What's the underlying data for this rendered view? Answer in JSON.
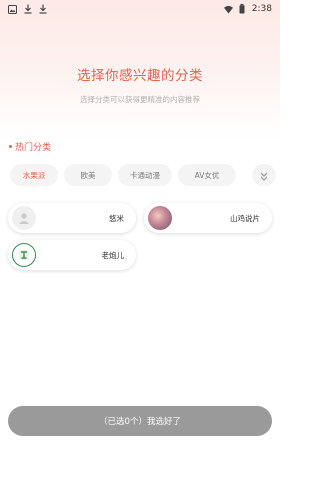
{
  "status_bar": {
    "time": "2:38",
    "left_icons": [
      "image-icon",
      "download-icon",
      "download-icon"
    ],
    "right_icons": [
      "wifi-icon",
      "battery-icon"
    ]
  },
  "header": {
    "title": "选择你感兴趣的分类",
    "subtitle": "选择分类可以获得更精准的内容推荐"
  },
  "hot_section": {
    "title": "热门分类"
  },
  "categories": [
    {
      "label": "水果派",
      "selected": true
    },
    {
      "label": "欧美",
      "selected": false
    },
    {
      "label": "卡通动漫",
      "selected": false
    },
    {
      "label": "AV女优",
      "selected": false
    }
  ],
  "cards": [
    {
      "label": "悠米",
      "avatar": "user-placeholder-icon"
    },
    {
      "label": "山鸡说片",
      "avatar": "avatar-photo"
    },
    {
      "label": "老炮儿",
      "avatar": "brand-logo-icon"
    }
  ],
  "confirm_button": {
    "label": "（已选0个）我选好了"
  },
  "colors": {
    "accent": "#e7614f",
    "chip_bg": "#f4f4f4",
    "button_bg": "#9a9a9a"
  }
}
